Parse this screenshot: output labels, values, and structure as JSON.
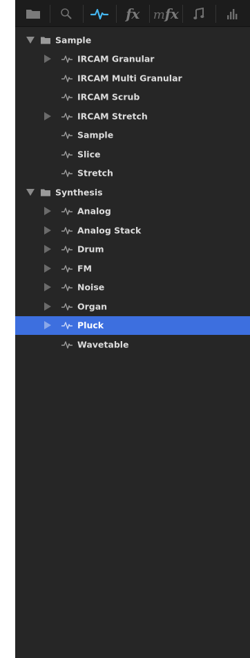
{
  "tabs": [
    {
      "name": "tab-browser",
      "icon": "folder-icon",
      "selected": false
    },
    {
      "name": "tab-search",
      "icon": "search-icon",
      "selected": false
    },
    {
      "name": "tab-instruments",
      "icon": "waveform-icon",
      "selected": true
    },
    {
      "name": "tab-fx",
      "icon": "fx-icon",
      "label": "fx",
      "selected": false
    },
    {
      "name": "tab-mfx",
      "icon": "mfx-icon",
      "label_m": "m",
      "label_fx": "fx",
      "selected": false
    },
    {
      "name": "tab-patterns",
      "icon": "music-note-icon",
      "selected": false
    },
    {
      "name": "tab-meters",
      "icon": "bar-graph-icon",
      "selected": false
    }
  ],
  "colors": {
    "accent": "#45b6f0",
    "selection": "#3d6fdf",
    "panel": "#262626"
  },
  "tree": {
    "sample": {
      "label": "Sample",
      "children": [
        {
          "label": "IRCAM Granular",
          "expandable": true
        },
        {
          "label": "IRCAM Multi Granular",
          "expandable": false
        },
        {
          "label": "IRCAM Scrub",
          "expandable": false
        },
        {
          "label": "IRCAM Stretch",
          "expandable": true
        },
        {
          "label": "Sample",
          "expandable": false
        },
        {
          "label": "Slice",
          "expandable": false
        },
        {
          "label": "Stretch",
          "expandable": false
        }
      ]
    },
    "synthesis": {
      "label": "Synthesis",
      "children": [
        {
          "label": "Analog",
          "expandable": true
        },
        {
          "label": "Analog Stack",
          "expandable": true
        },
        {
          "label": "Drum",
          "expandable": true
        },
        {
          "label": "FM",
          "expandable": true
        },
        {
          "label": "Noise",
          "expandable": true
        },
        {
          "label": "Organ",
          "expandable": true
        },
        {
          "label": "Pluck",
          "expandable": true,
          "selected": true
        },
        {
          "label": "Wavetable",
          "expandable": false
        }
      ]
    }
  }
}
